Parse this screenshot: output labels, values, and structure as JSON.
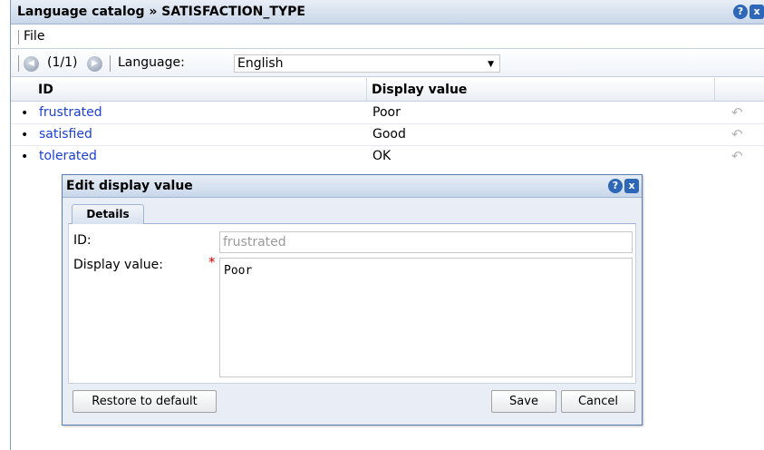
{
  "window": {
    "title": "Language catalog » SATISFACTION_TYPE",
    "help_icon": "?",
    "close_icon": "x"
  },
  "menu": {
    "file_label": "File"
  },
  "toolbar": {
    "prev_icon": "◀",
    "page_count": "(1/1)",
    "next_icon": "▶",
    "language_label": "Language:",
    "language_value": "English"
  },
  "table": {
    "headers": {
      "id": "ID",
      "display_value": "Display value"
    },
    "rows": [
      {
        "id": "frustrated",
        "value": "Poor"
      },
      {
        "id": "satisfied",
        "value": "Good"
      },
      {
        "id": "tolerated",
        "value": "OK"
      }
    ],
    "undo_icon": "undo-icon"
  },
  "dialog": {
    "title": "Edit display value",
    "tab_details": "Details",
    "id_label": "ID:",
    "id_value": "frustrated",
    "display_label": "Display value:",
    "required_mark": "*",
    "display_value": "Poor",
    "restore_label": "Restore to default",
    "save_label": "Save",
    "cancel_label": "Cancel"
  },
  "colors": {
    "link": "#1a3fd4",
    "title_bar": "#c9d7ea",
    "required": "#d40000"
  }
}
